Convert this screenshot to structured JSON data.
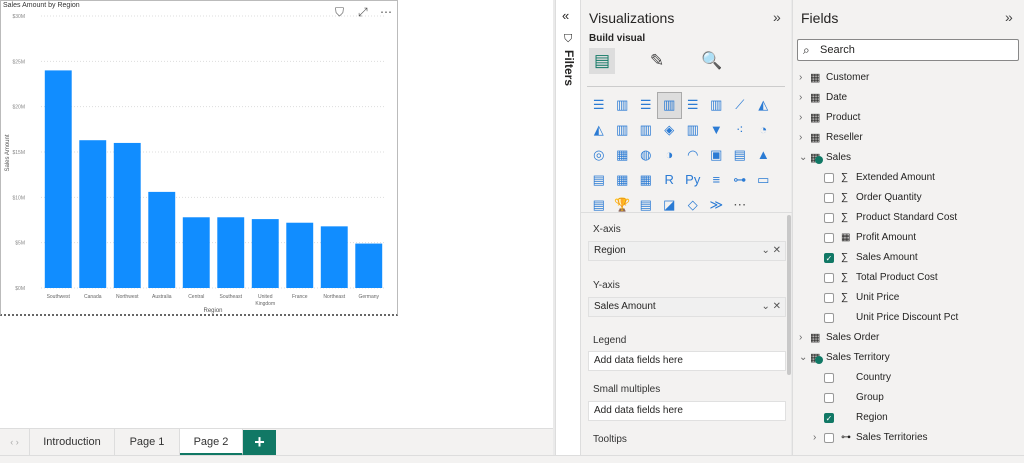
{
  "chart_data": {
    "type": "bar",
    "title": "Sales Amount by Region",
    "xlabel": "Region",
    "ylabel": "Sales Amount",
    "categories": [
      "Southwest",
      "Canada",
      "Northwest",
      "Australia",
      "Central",
      "Southeast",
      "United Kingdom",
      "France",
      "Northeast",
      "Germany"
    ],
    "values": [
      24.0,
      16.3,
      16.0,
      10.6,
      7.8,
      7.8,
      7.6,
      7.2,
      6.8,
      4.9
    ],
    "units": "$M",
    "ylim": [
      0,
      30
    ],
    "yticks": [
      "$0M",
      "$5M",
      "$10M",
      "$15M",
      "$20M",
      "$25M",
      "$30M"
    ],
    "grid": true,
    "color": "#118DFF"
  },
  "visual_icons": {
    "filter": "filter-icon",
    "focus": "focus-mode-icon",
    "more": "⋯"
  },
  "tabs": [
    "Introduction",
    "Page 1",
    "Page 2"
  ],
  "active_tab": "Page 2",
  "add_label": "+",
  "filters": {
    "label": "Filters"
  },
  "visualizations": {
    "title": "Visualizations",
    "build": "Build visual",
    "icons": [
      "stacked-bar",
      "stacked-column",
      "clustered-bar",
      "clustered-column",
      "100-bar",
      "100-column",
      "line",
      "area",
      "stacked-area",
      "line-stacked-column",
      "line-clustered-column",
      "ribbon",
      "waterfall",
      "funnel",
      "scatter",
      "pie",
      "donut",
      "treemap",
      "map",
      "filled-map",
      "gauge",
      "card",
      "multi-row-card",
      "kpi",
      "slicer",
      "table",
      "matrix",
      "r-visual",
      "python-visual",
      "key-influencers",
      "decomposition-tree",
      "qa",
      "smart-narrative",
      "trophy",
      "paginated",
      "azure-map",
      "power-apps",
      "power-automate",
      "more"
    ],
    "glyphs": [
      "☰",
      "▥",
      "☰",
      "▥",
      "☰",
      "▥",
      "⟋",
      "◭",
      "◭",
      "▥",
      "▥",
      "◈",
      "▥",
      "▼",
      "⁖",
      "◔",
      "◎",
      "▦",
      "◍",
      "◑",
      "◠",
      "▣",
      "▤",
      "▲",
      "▤",
      "▦",
      "▦",
      "R",
      "Py",
      "≡",
      "⊶",
      "▭",
      "▤",
      "🏆",
      "▤",
      "◪",
      "◇",
      "≫",
      "⋯"
    ],
    "x_axis": {
      "label": "X-axis",
      "value": "Region"
    },
    "y_axis": {
      "label": "Y-axis",
      "value": "Sales Amount"
    },
    "legend": {
      "label": "Legend",
      "placeholder": "Add data fields here"
    },
    "small_multiples": {
      "label": "Small multiples",
      "placeholder": "Add data fields here"
    },
    "tooltips": {
      "label": "Tooltips"
    }
  },
  "fields": {
    "title": "Fields",
    "search_placeholder": "Search",
    "items": [
      {
        "level": 0,
        "label": "Customer",
        "expand": ">",
        "icon": "table"
      },
      {
        "level": 0,
        "label": "Date",
        "expand": ">",
        "icon": "table"
      },
      {
        "level": 0,
        "label": "Product",
        "expand": ">",
        "icon": "table"
      },
      {
        "level": 0,
        "label": "Reseller",
        "expand": ">",
        "icon": "table"
      },
      {
        "level": 0,
        "label": "Sales",
        "expand": "v",
        "icon": "table-checked"
      },
      {
        "level": 1,
        "label": "Extended Amount",
        "icon": "sigma",
        "checked": false
      },
      {
        "level": 1,
        "label": "Order Quantity",
        "icon": "sigma",
        "checked": false
      },
      {
        "level": 1,
        "label": "Product Standard Cost",
        "icon": "sigma",
        "checked": false
      },
      {
        "level": 1,
        "label": "Profit Amount",
        "icon": "measure",
        "checked": false
      },
      {
        "level": 1,
        "label": "Sales Amount",
        "icon": "sigma",
        "checked": true
      },
      {
        "level": 1,
        "label": "Total Product Cost",
        "icon": "sigma",
        "checked": false
      },
      {
        "level": 1,
        "label": "Unit Price",
        "icon": "sigma",
        "checked": false
      },
      {
        "level": 1,
        "label": "Unit Price Discount Pct",
        "icon": "",
        "checked": false
      },
      {
        "level": 0,
        "label": "Sales Order",
        "expand": ">",
        "icon": "table"
      },
      {
        "level": 0,
        "label": "Sales Territory",
        "expand": "v",
        "icon": "table-checked"
      },
      {
        "level": 1,
        "label": "Country",
        "icon": "",
        "checked": false
      },
      {
        "level": 1,
        "label": "Group",
        "icon": "",
        "checked": false
      },
      {
        "level": 1,
        "label": "Region",
        "icon": "",
        "checked": true
      },
      {
        "level": 1,
        "label": "Sales Territories",
        "icon": "hierarchy",
        "checked": false,
        "expand": ">"
      }
    ]
  }
}
